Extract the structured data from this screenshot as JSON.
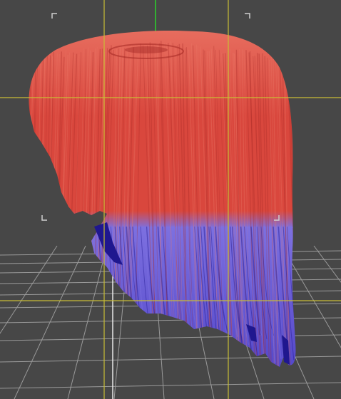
{
  "viewport": {
    "background_color": "#474747",
    "grid_color": "#9a9a9a",
    "guide_line_color": "#c8bd35",
    "y_axis_color": "#2bd42b",
    "frame_corner_color": "#d0d0d0"
  },
  "model": {
    "object": "hair-mesh",
    "top_color": "#d9473d",
    "top_highlight_color": "#ec7a6a",
    "top_shadow_color": "#a82c27",
    "bottom_color": "#4a3ec4",
    "bottom_highlight_color": "#7d70e0",
    "bottom_shadow_color": "#1f178f"
  }
}
